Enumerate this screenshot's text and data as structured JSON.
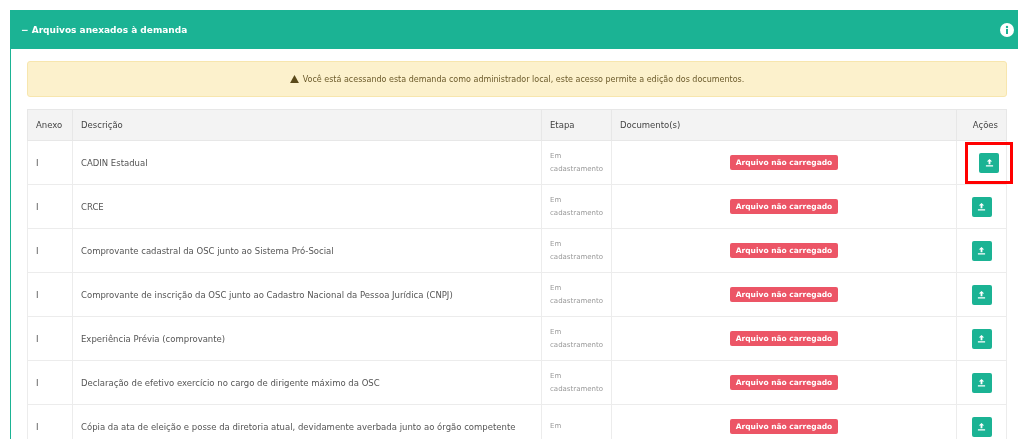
{
  "panel": {
    "title": "Arquivos anexados à demanda",
    "collapse_symbol": "−"
  },
  "alert": {
    "text": "Você está acessando esta demanda como administrador local, este acesso permite a edição dos documentos."
  },
  "table": {
    "columns": [
      "Anexo",
      "Descrição",
      "Etapa",
      "Documento(s)",
      "Ações"
    ],
    "rows": [
      {
        "anexo": "I",
        "descricao": "CADIN Estadual",
        "etapa": "Em cadastramento",
        "documento": "Arquivo não carregado",
        "highlighted": true
      },
      {
        "anexo": "I",
        "descricao": "CRCE",
        "etapa": "Em cadastramento",
        "documento": "Arquivo não carregado",
        "highlighted": false
      },
      {
        "anexo": "I",
        "descricao": "Comprovante cadastral da OSC junto ao Sistema Pró-Social",
        "etapa": "Em cadastramento",
        "documento": "Arquivo não carregado",
        "highlighted": false
      },
      {
        "anexo": "I",
        "descricao": "Comprovante de inscrição da OSC junto ao Cadastro Nacional da Pessoa Jurídica (CNPJ)",
        "etapa": "Em cadastramento",
        "documento": "Arquivo não carregado",
        "highlighted": false
      },
      {
        "anexo": "I",
        "descricao": "Experiência Prévia (comprovante)",
        "etapa": "Em cadastramento",
        "documento": "Arquivo não carregado",
        "highlighted": false
      },
      {
        "anexo": "I",
        "descricao": "Declaração de efetivo exercício no cargo de dirigente máximo da OSC",
        "etapa": "Em cadastramento",
        "documento": "Arquivo não carregado",
        "highlighted": false
      },
      {
        "anexo": "I",
        "descricao": "Cópia da ata de eleição e posse da diretoria atual, devidamente averbada junto ao órgão competente",
        "etapa": "Em",
        "documento": "Arquivo não carregado",
        "highlighted": false
      }
    ]
  }
}
